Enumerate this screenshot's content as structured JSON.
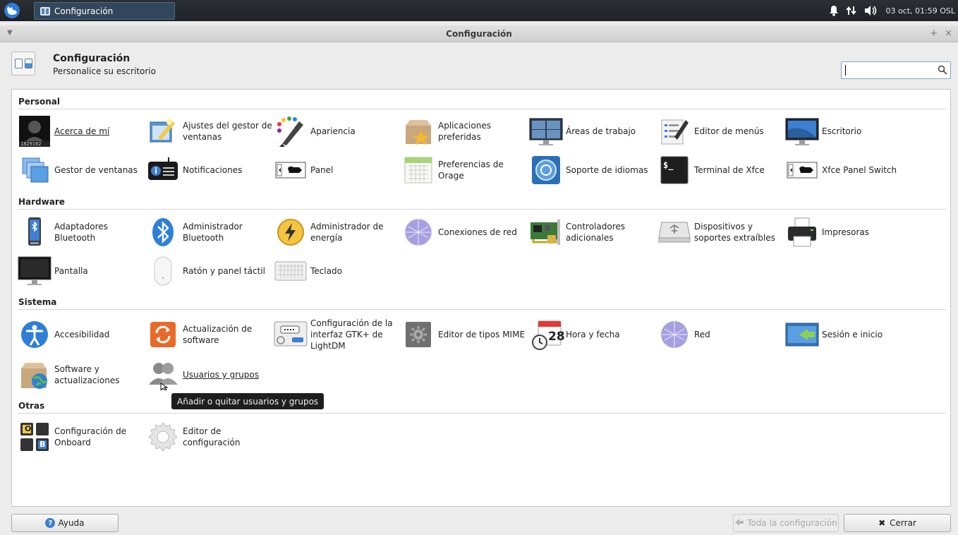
{
  "taskbar": {
    "window_button": "Configuración",
    "clock": "03 oct, 01:59 OSL"
  },
  "window": {
    "title": "Configuración",
    "controls": [
      "+",
      "×"
    ]
  },
  "header": {
    "title": "Configuración",
    "subtitle": "Personalice su escritorio",
    "search_value": ""
  },
  "sections": {
    "personal": "Personal",
    "hardware": "Hardware",
    "sistema": "Sistema",
    "otras": "Otras"
  },
  "items": {
    "acerca_de_mi": "Acerca de mí",
    "ajustes_gestor": "Ajustes del gestor de ventanas",
    "apariencia": "Apariencia",
    "aplicaciones_preferidas": "Aplicaciones preferidas",
    "areas_trabajo": "Áreas de trabajo",
    "editor_menus": "Editor de menús",
    "escritorio": "Escritorio",
    "gestor_ventanas": "Gestor de ventanas",
    "notificaciones": "Notificaciones",
    "panel": "Panel",
    "preferencias_orage": "Preferencias de Orage",
    "soporte_idiomas": "Soporte de idiomas",
    "terminal_xfce": "Terminal de Xfce",
    "xfce_panel_switch": "Xfce Panel Switch",
    "adaptadores_bluetooth": "Adaptadores Bluetooth",
    "administrador_bluetooth": "Administrador Bluetooth",
    "administrador_energia": "Administrador de energía",
    "conexiones_red": "Conexiones de red",
    "controladores_adicionales": "Controladores adicionales",
    "dispositivos": "Dispositivos y soportes extraíbles",
    "impresoras": "Impresoras",
    "pantalla": "Pantalla",
    "raton": "Ratón y panel táctil",
    "teclado": "Teclado",
    "accesibilidad": "Accesibilidad",
    "actualizacion_software": "Actualización de software",
    "configuracion_lightdm": "Configuración de la interfaz GTK+ de LightDM",
    "editor_mime": "Editor de tipos MIME",
    "hora_fecha": "Hora y fecha",
    "red": "Red",
    "sesion_inicio": "Sesión e inicio",
    "software_actualizaciones": "Software y actualizaciones",
    "usuarios_grupos": "Usuarios y grupos",
    "configuracion_onboard": "Configuración de Onboard",
    "editor_configuracion": "Editor de configuración"
  },
  "icon_text": {
    "avatar_id": "1829102",
    "calendar_day": "28",
    "terminal_prompt": "$_",
    "onboard_keys": [
      "O",
      "B"
    ]
  },
  "tooltip": "Añadir o quitar usuarios y grupos",
  "buttons": {
    "help": "Ayuda",
    "all_settings": "Toda la configuración",
    "close": "Cerrar"
  }
}
